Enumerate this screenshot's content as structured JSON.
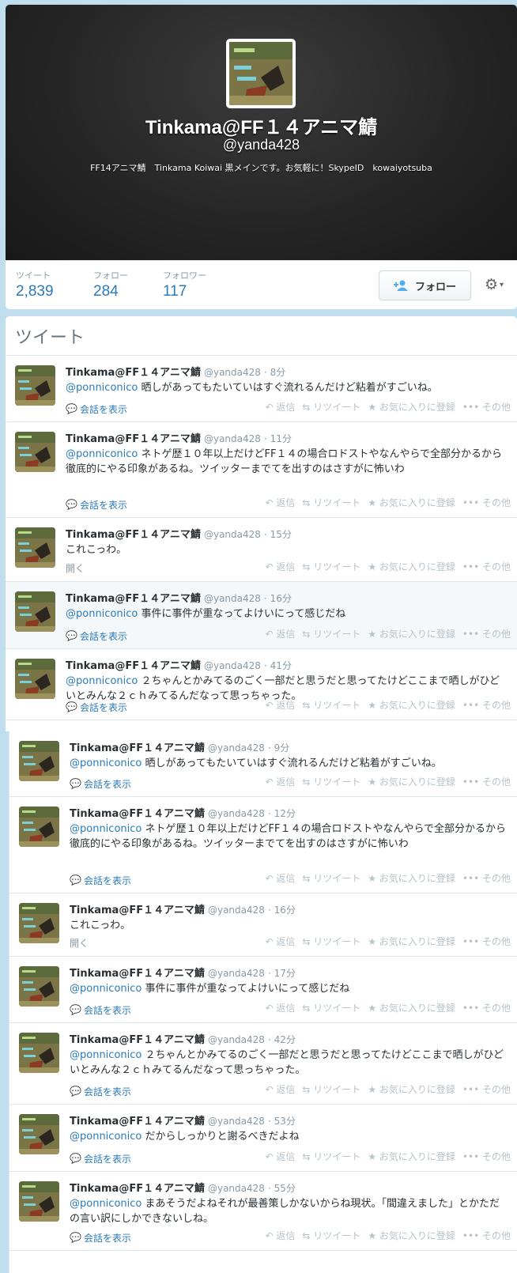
{
  "profile": {
    "name": "Tinkama@FF１４アニマ鯖",
    "handle": "@yanda428",
    "bio": "FF14アニマ鯖　Tinkama Koiwai 黒メインです。お気軽に！SkypeID　kowaiyotsuba"
  },
  "stats": {
    "tweets_label": "ツイート",
    "tweets": "2,839",
    "following_label": "フォロー",
    "following": "284",
    "followers_label": "フォロワー",
    "followers": "117",
    "follow_button": "フォロー"
  },
  "timeline": {
    "title": "ツイート"
  },
  "actions": {
    "reply": "返信",
    "retweet": "リツイート",
    "favorite": "お気に入りに登録",
    "more": "その他",
    "show_conversation": "会話を表示",
    "expand": "開く"
  },
  "tweets_upper": [
    {
      "name": "Tinkama@FF１４アニマ鯖",
      "handle": "@yanda428",
      "time": "· 8分",
      "mention": "@ponniconico",
      "text": " 晒しがあってもたいていはすぐ流れるんだけど粘着がすごいね。"
    },
    {
      "name": "Tinkama@FF１４アニマ鯖",
      "handle": "@yanda428",
      "time": "· 11分",
      "mention": "@ponniconico",
      "text": " ネトゲ歴１０年以上だけどFF１４の場合ロドストやなんやらで全部分かるから徹底的にやる印象があるね。ツイッターまでてを出すのはさすがに怖いわ"
    },
    {
      "name": "Tinkama@FF１４アニマ鯖",
      "handle": "@yanda428",
      "time": "· 15分",
      "mention": "",
      "text": "これこっわ。"
    },
    {
      "name": "Tinkama@FF１４アニマ鯖",
      "handle": "@yanda428",
      "time": "· 16分",
      "mention": "@ponniconico",
      "text": " 事件に事件が重なってよけいにって感じだね"
    },
    {
      "name": "Tinkama@FF１４アニマ鯖",
      "handle": "@yanda428",
      "time": "· 41分",
      "mention": "@ponniconico",
      "text": " ２ちゃんとかみてるのごく一部だと思うだと思ってたけどここまで晒しがひどいとみんな２ｃｈみてるんだなって思っちゃった。"
    }
  ],
  "tweets_lower": [
    {
      "name": "Tinkama@FF１４アニマ鯖",
      "handle": "@yanda428",
      "time": "· 9分",
      "mention": "@ponniconico",
      "text": " 晒しがあってもたいていはすぐ流れるんだけど粘着がすごいね。"
    },
    {
      "name": "Tinkama@FF１４アニマ鯖",
      "handle": "@yanda428",
      "time": "· 12分",
      "mention": "@ponniconico",
      "text": " ネトゲ歴１０年以上だけどFF１４の場合ロドストやなんやらで全部分かるから徹底的にやる印象があるね。ツイッターまでてを出すのはさすがに怖いわ"
    },
    {
      "name": "Tinkama@FF１４アニマ鯖",
      "handle": "@yanda428",
      "time": "· 16分",
      "mention": "",
      "text": "これこっわ。"
    },
    {
      "name": "Tinkama@FF１４アニマ鯖",
      "handle": "@yanda428",
      "time": "· 17分",
      "mention": "@ponniconico",
      "text": " 事件に事件が重なってよけいにって感じだね"
    },
    {
      "name": "Tinkama@FF１４アニマ鯖",
      "handle": "@yanda428",
      "time": "· 42分",
      "mention": "@ponniconico",
      "text": " ２ちゃんとかみてるのごく一部だと思うだと思ってたけどここまで晒しがひどいとみんな２ｃｈみてるんだなって思っちゃった。"
    },
    {
      "name": "Tinkama@FF１４アニマ鯖",
      "handle": "@yanda428",
      "time": "· 53分",
      "mention": "@ponniconico",
      "text": " だからしっかりと謝るべきだよね"
    },
    {
      "name": "Tinkama@FF１４アニマ鯖",
      "handle": "@yanda428",
      "time": "· 55分",
      "mention": "@ponniconico",
      "text": " まあそうだよねそれが最善策しかないからね現状。「間違えました」とかただの言い訳にしかできないしね。"
    }
  ]
}
